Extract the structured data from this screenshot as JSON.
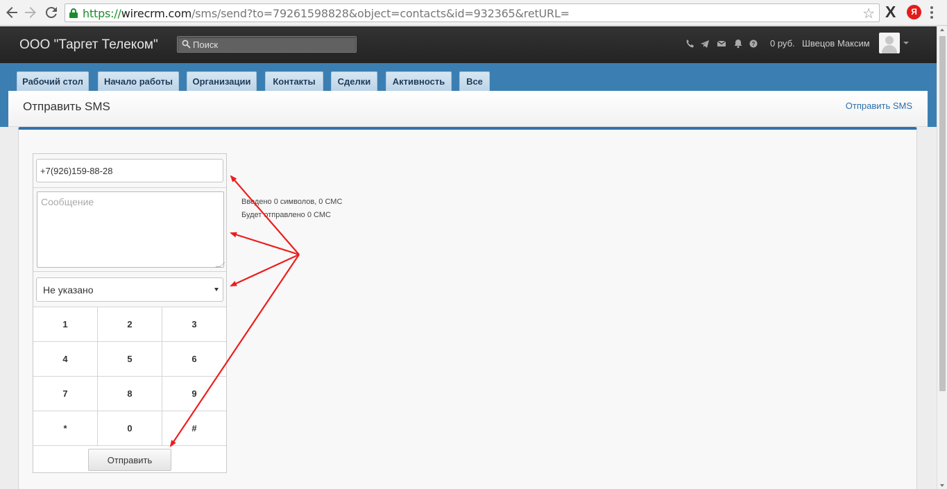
{
  "browser": {
    "url_scheme": "https://",
    "url_host": "wirecrm.com",
    "url_path": "/sms/send?to=79261598828&object=contacts&id=932365&retURL=",
    "ext_x_label": "X",
    "ext_ya_label": "Я"
  },
  "header": {
    "brand": "ООО \"Таргет Телеком\"",
    "search_placeholder": "Поиск",
    "balance": "0 руб.",
    "user_name": "Швецов Максим"
  },
  "nav": {
    "tabs": [
      {
        "label": "Рабочий стол"
      },
      {
        "label": "Начало работы"
      },
      {
        "label": "Организации"
      },
      {
        "label": "Контакты"
      },
      {
        "label": "Сделки"
      },
      {
        "label": "Активность"
      },
      {
        "label": "Все"
      }
    ]
  },
  "page": {
    "title": "Отправить SMS",
    "title_link": "Отправить SMS"
  },
  "form": {
    "phone_value": "+7(926)159-88-28",
    "message_placeholder": "Сообщение",
    "sender_select_value": "Не указано",
    "keypad": [
      "1",
      "2",
      "3",
      "4",
      "5",
      "6",
      "7",
      "8",
      "9",
      "*",
      "0",
      "#"
    ],
    "send_label": "Отправить",
    "info_chars": "Введено 0 символов, 0 СМС",
    "info_will_send": "Будет отправлено 0 СМС"
  },
  "colors": {
    "nav_blue": "#3b7fb2",
    "header_dark": "#2b2b2b",
    "accent_link": "#2d6fa7",
    "annotation_arrow": "#ee1c1c"
  }
}
